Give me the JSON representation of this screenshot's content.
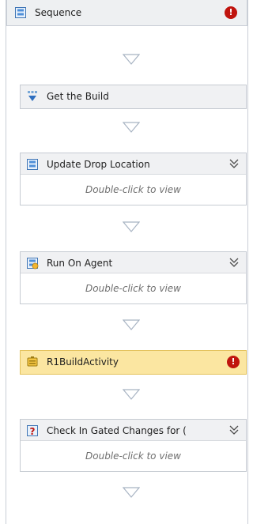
{
  "sequence": {
    "title": "Sequence",
    "has_error": true
  },
  "activities": [
    {
      "title": "Get the Build",
      "collapsed_text": "",
      "has_error": false,
      "expandable": false
    },
    {
      "title": "Update Drop Location",
      "collapsed_text": "Double-click to view",
      "has_error": false,
      "expandable": true
    },
    {
      "title": "Run On Agent",
      "collapsed_text": "Double-click to view",
      "has_error": false,
      "expandable": true
    },
    {
      "title": "R1BuildActivity",
      "collapsed_text": "",
      "has_error": true,
      "expandable": false
    },
    {
      "title": "Check In Gated Changes for (",
      "collapsed_text": "Double-click to view",
      "has_error": false,
      "expandable": true
    }
  ],
  "icons": {
    "sequence": "sequence-icon",
    "error": "error-icon",
    "drop_target": "drop-target-icon",
    "expand": "expand-chevron-icon",
    "get_build": "get-build-icon",
    "run_on_agent": "agent-icon",
    "activity": "activity-icon",
    "check_in": "check-in-icon"
  },
  "error_glyph": "!",
  "colors": {
    "highlight_header": "#fbe6a1",
    "error": "#c0140e",
    "drop_arrow": "#a7b3c2"
  }
}
